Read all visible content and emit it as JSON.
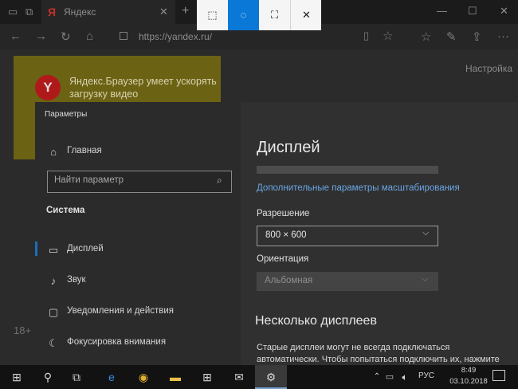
{
  "browser": {
    "tab_title": "Яндекс",
    "tab_logo": "Я",
    "address": "https://yandex.ru/",
    "promo": {
      "logo": "Y",
      "text": "Яндекс.Браузер умеет ускорять загрузку видео"
    },
    "settings_link": "Настройка",
    "age_badge": "18+"
  },
  "snip_toolbar": {
    "buttons": [
      "rectangular-snip",
      "freeform-snip",
      "fullscreen-snip",
      "close"
    ],
    "active": "freeform-snip",
    "accent": "#0a78d7"
  },
  "settings": {
    "window_title": "Параметры",
    "home_label": "Главная",
    "search_placeholder": "Найти параметр",
    "section": "Система",
    "nav_items": [
      {
        "label": "Дисплей",
        "icon": "monitor-icon"
      },
      {
        "label": "Звук",
        "icon": "speaker-icon"
      },
      {
        "label": "Уведомления и действия",
        "icon": "notification-icon"
      },
      {
        "label": "Фокусировка внимания",
        "icon": "moon-icon"
      }
    ],
    "main": {
      "heading": "Дисплей",
      "scale_link": "Дополнительные параметры масштабирования",
      "resolution_label": "Разрешение",
      "resolution_value": "800 × 600",
      "orientation_label": "Ориентация",
      "orientation_value": "Альбомная",
      "multi_heading": "Несколько дисплеев",
      "multi_desc": "Старые дисплеи могут не всегда подключаться автоматически. Чтобы попытаться подключить их, нажмите"
    }
  },
  "taskbar": {
    "language": "РУС",
    "time": "8:49",
    "date": "03.10.2018"
  }
}
